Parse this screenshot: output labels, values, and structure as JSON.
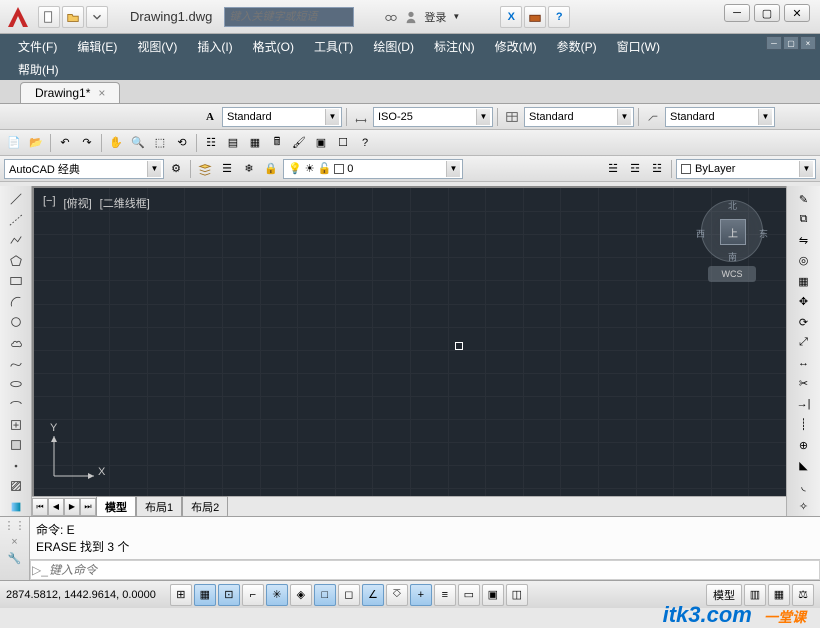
{
  "title_file": "Drawing1.dwg",
  "search_placeholder": "键入关键字或短语",
  "login_label": "登录",
  "menus": [
    "文件(F)",
    "编辑(E)",
    "视图(V)",
    "插入(I)",
    "格式(O)",
    "工具(T)",
    "绘图(D)",
    "标注(N)",
    "修改(M)",
    "参数(P)",
    "窗口(W)"
  ],
  "menus2": [
    "帮助(H)"
  ],
  "doc_tab": "Drawing1*",
  "workspace_combo": "AutoCAD 经典",
  "style_combo1": "Standard",
  "style_combo2": "ISO-25",
  "style_combo3": "Standard",
  "style_combo4": "Standard",
  "layer_combo": "0",
  "bylayer_combo": "ByLayer",
  "viewport_labels": [
    "[−]",
    "[俯视]",
    "[二维线框]"
  ],
  "viewcube_face": "上",
  "viewcube_dirs": {
    "n": "北",
    "e": "东",
    "s": "南",
    "w": "西"
  },
  "wcs": "WCS",
  "model_tabs": [
    "模型",
    "布局1",
    "布局2"
  ],
  "cmd_history": [
    "命令: E",
    "ERASE 找到 3 个"
  ],
  "cmd_placeholder": "键入命令",
  "coords": "2874.5812, 1442.9614, 0.0000",
  "sb_right_label": "模型",
  "watermark": {
    "a": "itk3",
    "b": ".com",
    "c": "一堂课"
  }
}
